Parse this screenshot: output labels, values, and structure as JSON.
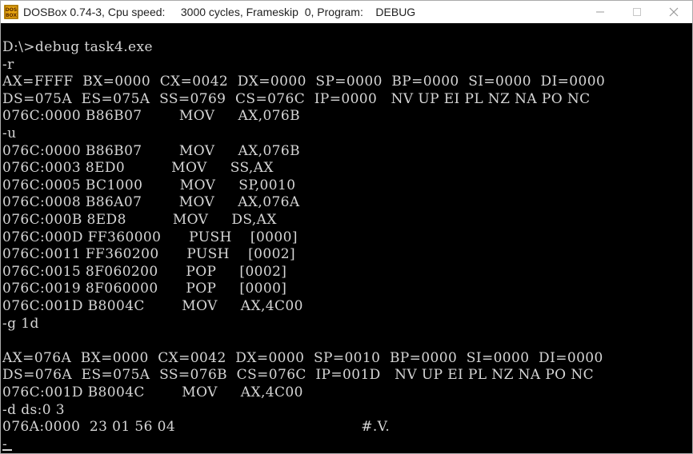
{
  "window": {
    "title": "DOSBox 0.74-3, Cpu speed:     3000 cycles, Frameskip  0, Program:    DEBUG",
    "icon": "dosbox-icon",
    "controls": [
      "minimize-icon",
      "maximize-icon",
      "close-icon"
    ]
  },
  "terminal": {
    "lines": [
      "",
      "D:\\>debug task4.exe",
      "-r",
      "AX=FFFF  BX=0000  CX=0042  DX=0000  SP=0000  BP=0000  SI=0000  DI=0000",
      "DS=075A  ES=075A  SS=0769  CS=076C  IP=0000   NV UP EI PL NZ NA PO NC",
      "076C:0000 B86B07        MOV     AX,076B",
      "-u",
      "076C:0000 B86B07        MOV     AX,076B",
      "076C:0003 8ED0          MOV     SS,AX",
      "076C:0005 BC1000        MOV     SP,0010",
      "076C:0008 B86A07        MOV     AX,076A",
      "076C:000B 8ED8          MOV     DS,AX",
      "076C:000D FF360000      PUSH    [0000]",
      "076C:0011 FF360200      PUSH    [0002]",
      "076C:0015 8F060200      POP     [0002]",
      "076C:0019 8F060000      POP     [0000]",
      "076C:001D B8004C        MOV     AX,4C00",
      "-g 1d",
      "",
      "AX=076A  BX=0000  CX=0042  DX=0000  SP=0010  BP=0000  SI=0000  DI=0000",
      "DS=076A  ES=075A  SS=076B  CS=076C  IP=001D   NV UP EI PL NZ NA PO NC",
      "076C:001D B8004C        MOV     AX,4C00",
      "-d ds:0 3",
      "076A:0000  23 01 56 04                                        #.V.",
      "-"
    ]
  }
}
